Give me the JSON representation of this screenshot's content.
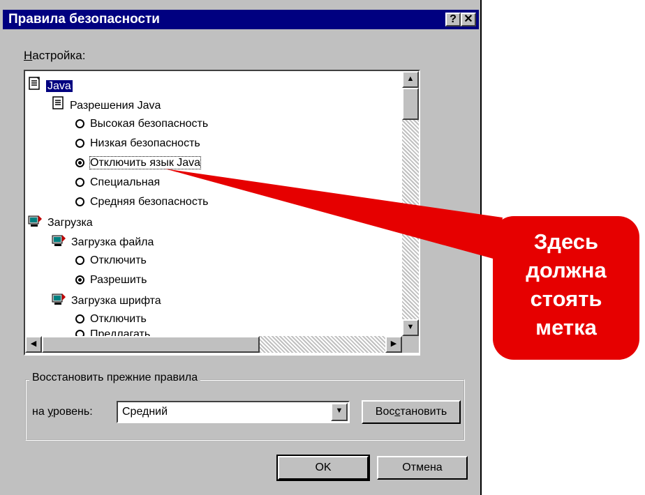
{
  "window": {
    "title": "Правила безопасности",
    "help_btn": "?",
    "close_btn": "✕"
  },
  "settings_label": {
    "mnemonic": "Н",
    "rest": "астройка:"
  },
  "tree": {
    "java": "Java",
    "java_perms": "Разрешения Java",
    "high": "Высокая безопасность",
    "low": "Низкая безопасность",
    "disable_java": "Отключить язык Java",
    "special": "Специальная",
    "medium": "Средняя безопасность",
    "download": "Загрузка",
    "file_download": "Загрузка файла",
    "file_disable": "Отключить",
    "file_enable": "Разрешить",
    "font_download": "Загрузка шрифта",
    "font_disable": "Отключить",
    "font_prompt": "Предлагать"
  },
  "restore_group": {
    "title": "Восстановить прежние правила",
    "level_label_pre": "на ",
    "level_label_mnemonic": "у",
    "level_label_post": "ровень:",
    "level_value": "Средний",
    "restore_pre": "Вос",
    "restore_mnemonic": "с",
    "restore_post": "тановить"
  },
  "buttons": {
    "ok": "OK",
    "cancel": "Отмена"
  },
  "callout": {
    "text": "Здесь\nдолжна\nстоять\nметка"
  },
  "colors": {
    "titlebar": "#000080",
    "callout": "#e60000",
    "face": "#c0c0c0"
  }
}
